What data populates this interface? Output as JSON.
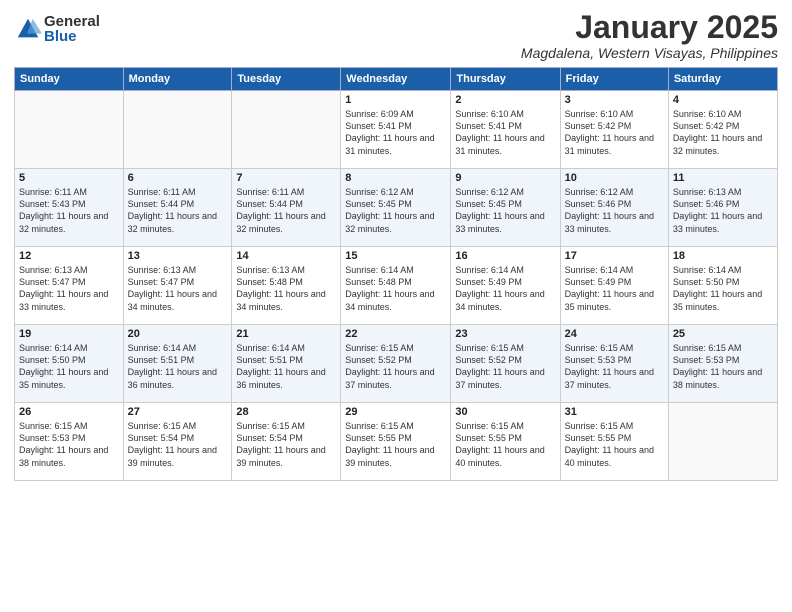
{
  "logo": {
    "general": "General",
    "blue": "Blue"
  },
  "title": "January 2025",
  "location": "Magdalena, Western Visayas, Philippines",
  "weekdays": [
    "Sunday",
    "Monday",
    "Tuesday",
    "Wednesday",
    "Thursday",
    "Friday",
    "Saturday"
  ],
  "weeks": [
    [
      {
        "day": "",
        "info": ""
      },
      {
        "day": "",
        "info": ""
      },
      {
        "day": "",
        "info": ""
      },
      {
        "day": "1",
        "sunrise": "6:09 AM",
        "sunset": "5:41 PM",
        "daylight": "11 hours and 31 minutes."
      },
      {
        "day": "2",
        "sunrise": "6:10 AM",
        "sunset": "5:41 PM",
        "daylight": "11 hours and 31 minutes."
      },
      {
        "day": "3",
        "sunrise": "6:10 AM",
        "sunset": "5:42 PM",
        "daylight": "11 hours and 31 minutes."
      },
      {
        "day": "4",
        "sunrise": "6:10 AM",
        "sunset": "5:42 PM",
        "daylight": "11 hours and 32 minutes."
      }
    ],
    [
      {
        "day": "5",
        "sunrise": "6:11 AM",
        "sunset": "5:43 PM",
        "daylight": "11 hours and 32 minutes."
      },
      {
        "day": "6",
        "sunrise": "6:11 AM",
        "sunset": "5:44 PM",
        "daylight": "11 hours and 32 minutes."
      },
      {
        "day": "7",
        "sunrise": "6:11 AM",
        "sunset": "5:44 PM",
        "daylight": "11 hours and 32 minutes."
      },
      {
        "day": "8",
        "sunrise": "6:12 AM",
        "sunset": "5:45 PM",
        "daylight": "11 hours and 32 minutes."
      },
      {
        "day": "9",
        "sunrise": "6:12 AM",
        "sunset": "5:45 PM",
        "daylight": "11 hours and 33 minutes."
      },
      {
        "day": "10",
        "sunrise": "6:12 AM",
        "sunset": "5:46 PM",
        "daylight": "11 hours and 33 minutes."
      },
      {
        "day": "11",
        "sunrise": "6:13 AM",
        "sunset": "5:46 PM",
        "daylight": "11 hours and 33 minutes."
      }
    ],
    [
      {
        "day": "12",
        "sunrise": "6:13 AM",
        "sunset": "5:47 PM",
        "daylight": "11 hours and 33 minutes."
      },
      {
        "day": "13",
        "sunrise": "6:13 AM",
        "sunset": "5:47 PM",
        "daylight": "11 hours and 34 minutes."
      },
      {
        "day": "14",
        "sunrise": "6:13 AM",
        "sunset": "5:48 PM",
        "daylight": "11 hours and 34 minutes."
      },
      {
        "day": "15",
        "sunrise": "6:14 AM",
        "sunset": "5:48 PM",
        "daylight": "11 hours and 34 minutes."
      },
      {
        "day": "16",
        "sunrise": "6:14 AM",
        "sunset": "5:49 PM",
        "daylight": "11 hours and 34 minutes."
      },
      {
        "day": "17",
        "sunrise": "6:14 AM",
        "sunset": "5:49 PM",
        "daylight": "11 hours and 35 minutes."
      },
      {
        "day": "18",
        "sunrise": "6:14 AM",
        "sunset": "5:50 PM",
        "daylight": "11 hours and 35 minutes."
      }
    ],
    [
      {
        "day": "19",
        "sunrise": "6:14 AM",
        "sunset": "5:50 PM",
        "daylight": "11 hours and 35 minutes."
      },
      {
        "day": "20",
        "sunrise": "6:14 AM",
        "sunset": "5:51 PM",
        "daylight": "11 hours and 36 minutes."
      },
      {
        "day": "21",
        "sunrise": "6:14 AM",
        "sunset": "5:51 PM",
        "daylight": "11 hours and 36 minutes."
      },
      {
        "day": "22",
        "sunrise": "6:15 AM",
        "sunset": "5:52 PM",
        "daylight": "11 hours and 37 minutes."
      },
      {
        "day": "23",
        "sunrise": "6:15 AM",
        "sunset": "5:52 PM",
        "daylight": "11 hours and 37 minutes."
      },
      {
        "day": "24",
        "sunrise": "6:15 AM",
        "sunset": "5:53 PM",
        "daylight": "11 hours and 37 minutes."
      },
      {
        "day": "25",
        "sunrise": "6:15 AM",
        "sunset": "5:53 PM",
        "daylight": "11 hours and 38 minutes."
      }
    ],
    [
      {
        "day": "26",
        "sunrise": "6:15 AM",
        "sunset": "5:53 PM",
        "daylight": "11 hours and 38 minutes."
      },
      {
        "day": "27",
        "sunrise": "6:15 AM",
        "sunset": "5:54 PM",
        "daylight": "11 hours and 39 minutes."
      },
      {
        "day": "28",
        "sunrise": "6:15 AM",
        "sunset": "5:54 PM",
        "daylight": "11 hours and 39 minutes."
      },
      {
        "day": "29",
        "sunrise": "6:15 AM",
        "sunset": "5:55 PM",
        "daylight": "11 hours and 39 minutes."
      },
      {
        "day": "30",
        "sunrise": "6:15 AM",
        "sunset": "5:55 PM",
        "daylight": "11 hours and 40 minutes."
      },
      {
        "day": "31",
        "sunrise": "6:15 AM",
        "sunset": "5:55 PM",
        "daylight": "11 hours and 40 minutes."
      },
      {
        "day": "",
        "info": ""
      }
    ]
  ]
}
